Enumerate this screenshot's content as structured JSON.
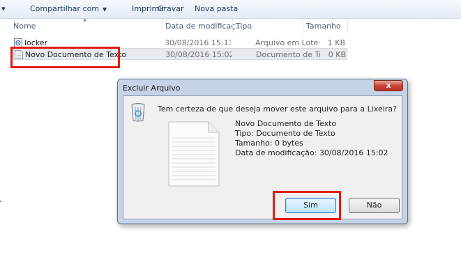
{
  "toolbar": {
    "partial_arrow": "▾",
    "share": "Compartilhar com",
    "share_arrow": "▼",
    "print": "Imprimir",
    "burn": "Gravar",
    "new_folder": "Nova pasta"
  },
  "columns": {
    "name": "Nome",
    "date": "Data de modificaç...",
    "type": "Tipo",
    "size": "Tamanho"
  },
  "files": [
    {
      "name": "locker",
      "date": "30/08/2016 15:11",
      "type": "Arquivo em Lotes ...",
      "size": "1 KB",
      "icon": "batch-file-icon"
    },
    {
      "name": "Novo Documento de Texto",
      "date": "30/08/2016 15:02",
      "type": "Documento de Te...",
      "size": "0 KB",
      "icon": "text-document-icon"
    }
  ],
  "dialog": {
    "title": "Excluir Arquivo",
    "close": "x",
    "question": "Tem certeza de que deseja mover este arquivo para a Lixeira?",
    "file_name": "Novo Documento de Texto",
    "file_type": "Tipo: Documento de Texto",
    "file_size": "Tamanho: 0 bytes",
    "file_modified": "Data de modificação: 30/08/2016 15:02",
    "yes": "Sim",
    "no": "Não"
  },
  "highlight_color": "#e11b14"
}
